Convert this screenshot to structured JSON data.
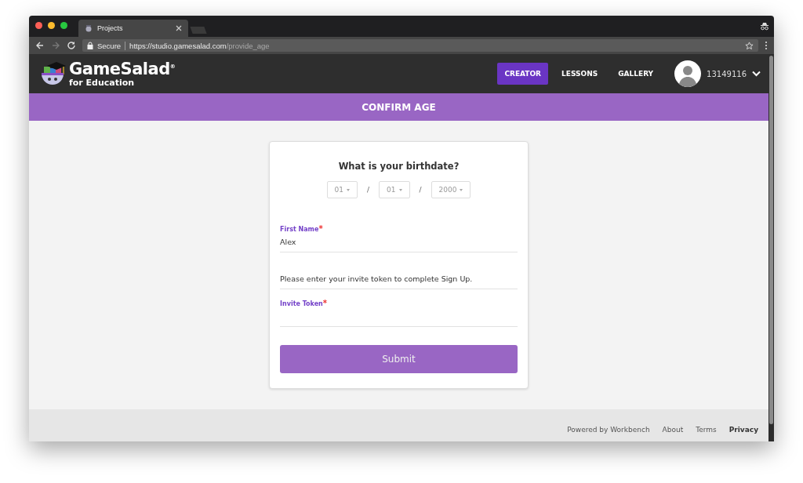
{
  "browser": {
    "tab_title": "Projects",
    "secure_label": "Secure",
    "url_host": "https://studio.gamesalad.com",
    "url_path": "/provide_age"
  },
  "header": {
    "logo_title": "GameSalad",
    "logo_mark": "®",
    "logo_subtitle": "for Education",
    "nav": [
      {
        "label": "CREATOR",
        "selected": true
      },
      {
        "label": "LESSONS",
        "selected": false
      },
      {
        "label": "GALLERY",
        "selected": false
      }
    ],
    "user_id": "13149116"
  },
  "banner": "CONFIRM AGE",
  "form": {
    "question": "What is your birthdate?",
    "date_fields": [
      {
        "value": "01"
      },
      {
        "value": "01"
      },
      {
        "value": "2000"
      }
    ],
    "separators": [
      "/",
      "/"
    ],
    "first_name": {
      "label": "First Name",
      "required_mark": "*",
      "value": "Alex"
    },
    "info": "Please enter your invite token to complete Sign Up.",
    "invite_token": {
      "label": "Invite Token",
      "required_mark": "*"
    },
    "submit": "Submit"
  },
  "footer": [
    {
      "label": "Powered by Workbench",
      "bold": false
    },
    {
      "label": "About",
      "bold": false
    },
    {
      "label": "Terms",
      "bold": false
    },
    {
      "label": "Privacy",
      "bold": true
    }
  ]
}
